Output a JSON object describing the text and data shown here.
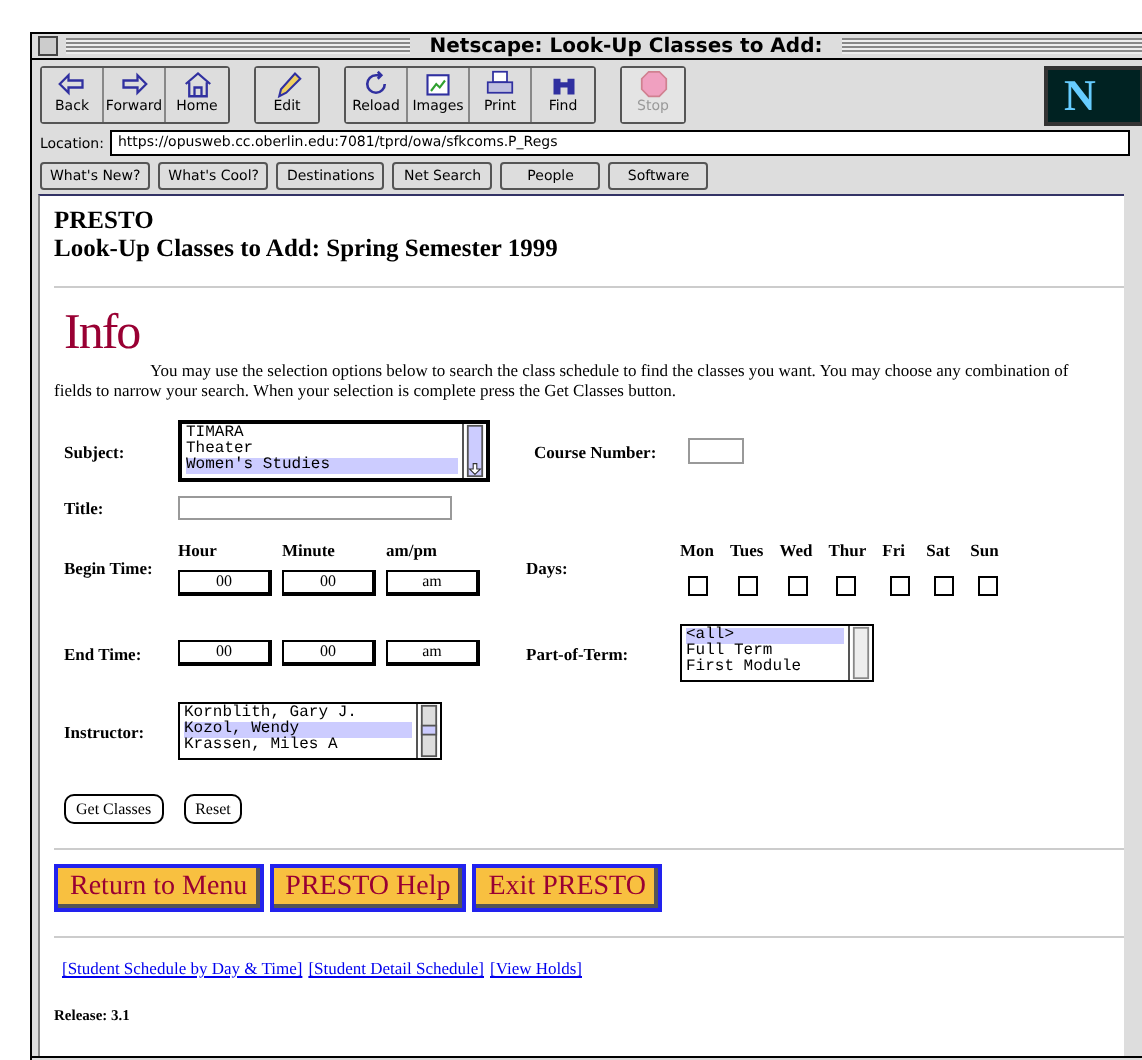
{
  "window": {
    "title": "Netscape: Look-Up Classes to Add:"
  },
  "toolbar": {
    "buttons": [
      {
        "label": "Back",
        "disabled": false
      },
      {
        "label": "Forward",
        "disabled": false
      },
      {
        "label": "Home",
        "disabled": false
      },
      {
        "label": "Edit",
        "disabled": false
      },
      {
        "label": "Reload",
        "disabled": false
      },
      {
        "label": "Images",
        "disabled": false
      },
      {
        "label": "Print",
        "disabled": false
      },
      {
        "label": "Find",
        "disabled": false
      },
      {
        "label": "Stop",
        "disabled": true
      }
    ],
    "logo": "N"
  },
  "location": {
    "label": "Location:",
    "value": "https://opusweb.cc.oberlin.edu:7081/tprd/owa/sfkcoms.P_Regs"
  },
  "directory_buttons": [
    "What's New?",
    "What's Cool?",
    "Destinations",
    "Net Search",
    "People",
    "Software"
  ],
  "page": {
    "heading": [
      "PRESTO",
      "Look-Up Classes to Add: Spring Semester 1999"
    ],
    "info_title": "Info",
    "intro": "You may use the selection options below to search the class schedule to find the classes you want. You may choose any combination of fields to narrow your search. When your selection is complete press the Get Classes button.",
    "subject": {
      "label": "Subject:",
      "items": [
        {
          "label": "TIMARA",
          "selected": false
        },
        {
          "label": "Theater",
          "selected": false
        },
        {
          "label": "Women's Studies",
          "selected": true
        }
      ]
    },
    "course_number": {
      "label": "Course Number:"
    },
    "title_field": {
      "label": "Title:"
    },
    "time_headers": [
      "Hour",
      "Minute",
      "am/pm"
    ],
    "begin_time": {
      "label": "Begin Time:",
      "values": [
        "00",
        "00",
        "am"
      ]
    },
    "end_time": {
      "label": "End Time:",
      "values": [
        "00",
        "00",
        "am"
      ]
    },
    "days": {
      "label": "Days:",
      "items": [
        {
          "label": "Mon",
          "checked": false
        },
        {
          "label": "Tues",
          "checked": false
        },
        {
          "label": "Wed",
          "checked": false
        },
        {
          "label": "Thur",
          "checked": false
        },
        {
          "label": "Fri",
          "checked": false
        },
        {
          "label": "Sat",
          "checked": false
        },
        {
          "label": "Sun",
          "checked": false
        }
      ]
    },
    "part_of_term": {
      "label": "Part-of-Term:",
      "items": [
        {
          "label": "<all>",
          "selected": true
        },
        {
          "label": "Full Term",
          "selected": false
        },
        {
          "label": "First Module",
          "selected": false
        }
      ]
    },
    "instructor": {
      "label": "Instructor:",
      "items": [
        {
          "label": "Kornblith, Gary J.",
          "selected": false
        },
        {
          "label": "Kozol, Wendy",
          "selected": true
        },
        {
          "label": "Krassen, Miles A",
          "selected": false
        }
      ]
    },
    "form_buttons": [
      "Get Classes",
      "Reset"
    ],
    "nav_buttons": [
      "Return to Menu",
      "PRESTO Help",
      "Exit PRESTO"
    ],
    "links": [
      "[Student Schedule by Day & Time]",
      "[Student Detail Schedule]",
      "[View Holds]"
    ],
    "release": "Release: 3.1"
  }
}
